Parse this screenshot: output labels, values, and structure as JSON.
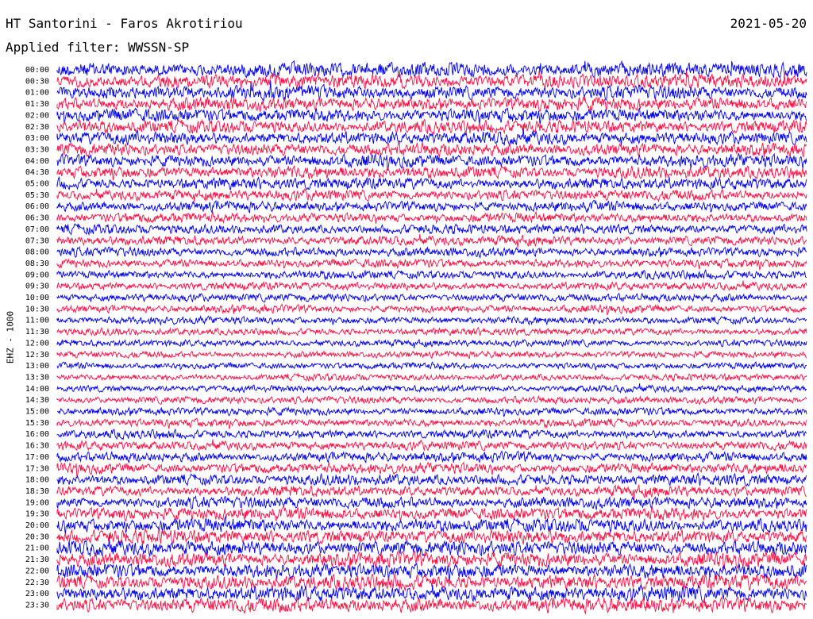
{
  "header": {
    "title": "HT Santorini - Faros Akrotiriou",
    "date": "2021-05-20",
    "filter": "Applied filter: WWSSN-SP"
  },
  "channel_label": "EHZ - 1000",
  "colors": {
    "trace_a": "#0000ee",
    "trace_b": "#ff1144",
    "background": "#ffffff",
    "text": "#000000"
  },
  "chart_data": {
    "type": "line",
    "title": "HT Santorini - Faros Akrotiriou",
    "ylabel": "EHZ - 1000",
    "xlabel": "",
    "grid": false,
    "legend": "none",
    "row_labels": [
      "00:00",
      "00:30",
      "01:00",
      "01:30",
      "02:00",
      "02:30",
      "03:00",
      "03:30",
      "04:00",
      "04:30",
      "05:00",
      "05:30",
      "06:00",
      "06:30",
      "07:00",
      "07:30",
      "08:00",
      "08:30",
      "09:00",
      "09:30",
      "10:00",
      "10:30",
      "11:00",
      "11:30",
      "12:00",
      "12:30",
      "13:00",
      "13:30",
      "14:00",
      "14:30",
      "15:00",
      "15:30",
      "16:00",
      "16:30",
      "17:00",
      "17:30",
      "18:00",
      "18:30",
      "19:00",
      "19:30",
      "20:00",
      "20:30",
      "21:00",
      "21:30",
      "22:00",
      "22:30",
      "23:00",
      "23:30"
    ],
    "row_colors": [
      "blue",
      "red"
    ],
    "relative_amplitude": [
      1.0,
      0.95,
      0.92,
      0.9,
      0.9,
      0.88,
      0.88,
      0.86,
      0.85,
      0.85,
      0.8,
      0.72,
      0.68,
      0.66,
      0.65,
      0.65,
      0.62,
      0.58,
      0.56,
      0.54,
      0.54,
      0.52,
      0.5,
      0.48,
      0.46,
      0.45,
      0.44,
      0.44,
      0.46,
      0.5,
      0.52,
      0.55,
      0.58,
      0.62,
      0.66,
      0.72,
      0.75,
      0.72,
      0.78,
      0.86,
      0.92,
      0.95,
      1.0,
      1.0,
      1.0,
      1.0,
      1.0,
      1.0
    ]
  }
}
